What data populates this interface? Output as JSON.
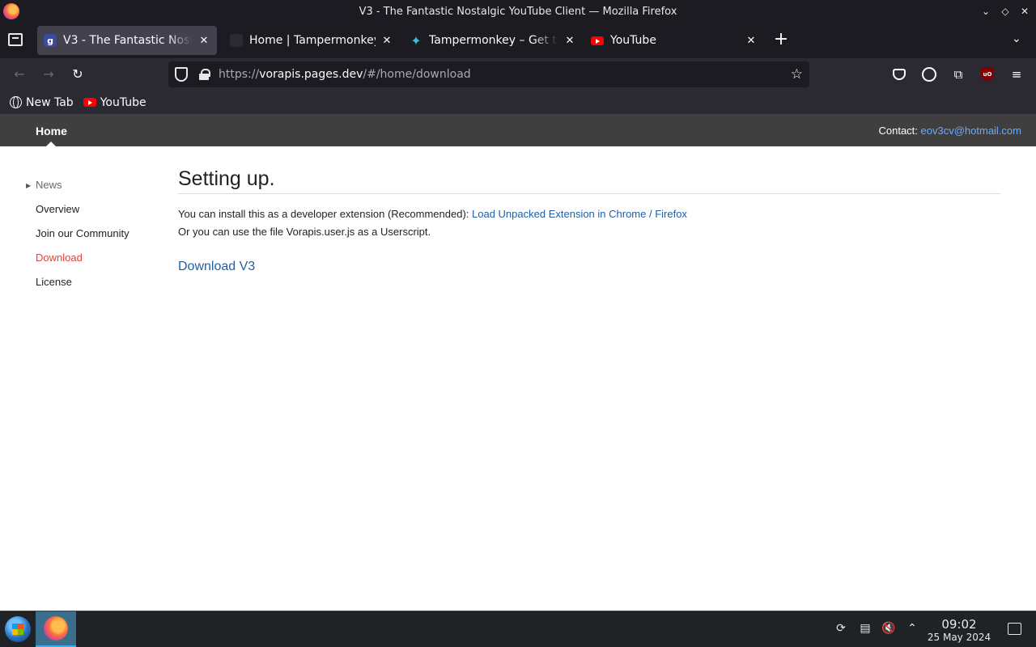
{
  "window": {
    "title": "V3 - The Fantastic Nostalgic YouTube Client — Mozilla Firefox"
  },
  "tabs": [
    {
      "label": "V3 - The Fantastic Nostalgic YouTube Client",
      "favicon": "g-favicon",
      "active": true
    },
    {
      "label": "Home | Tampermonkey",
      "favicon": "tampermonkey-icon",
      "active": false
    },
    {
      "label": "Tampermonkey – Get this Extension",
      "favicon": "tampermonkey-icon",
      "active": false
    },
    {
      "label": "YouTube",
      "favicon": "youtube-icon",
      "active": false
    }
  ],
  "navbar": {
    "url_prefix": "https://",
    "url_host": "vorapis.pages.dev",
    "url_path": "/#/home/download"
  },
  "bookmarks": [
    {
      "label": "New Tab",
      "icon": "globe-icon"
    },
    {
      "label": "YouTube",
      "icon": "youtube-icon"
    }
  ],
  "site": {
    "nav_home": "Home",
    "contact_label": "Contact:",
    "contact_email": "eov3cv@hotmail.com"
  },
  "sidenav": {
    "items": [
      "News",
      "Overview",
      "Join our Community",
      "Download",
      "License"
    ],
    "current": "Download"
  },
  "content": {
    "heading": "Setting up.",
    "line1_text": "You can install this as a developer extension (Recommended): ",
    "line1_link": "Load Unpacked Extension in Chrome / Firefox",
    "line2_text": "Or you can use the file Vorapis.user.js as a Userscript.",
    "download_link": "Download V3"
  },
  "taskbar": {
    "time": "09:02",
    "date": "25 May 2024"
  },
  "colors": {
    "accent_link": "#1f5fa8",
    "current_nav": "#e0443d",
    "header_bg": "#3f3f3f"
  }
}
